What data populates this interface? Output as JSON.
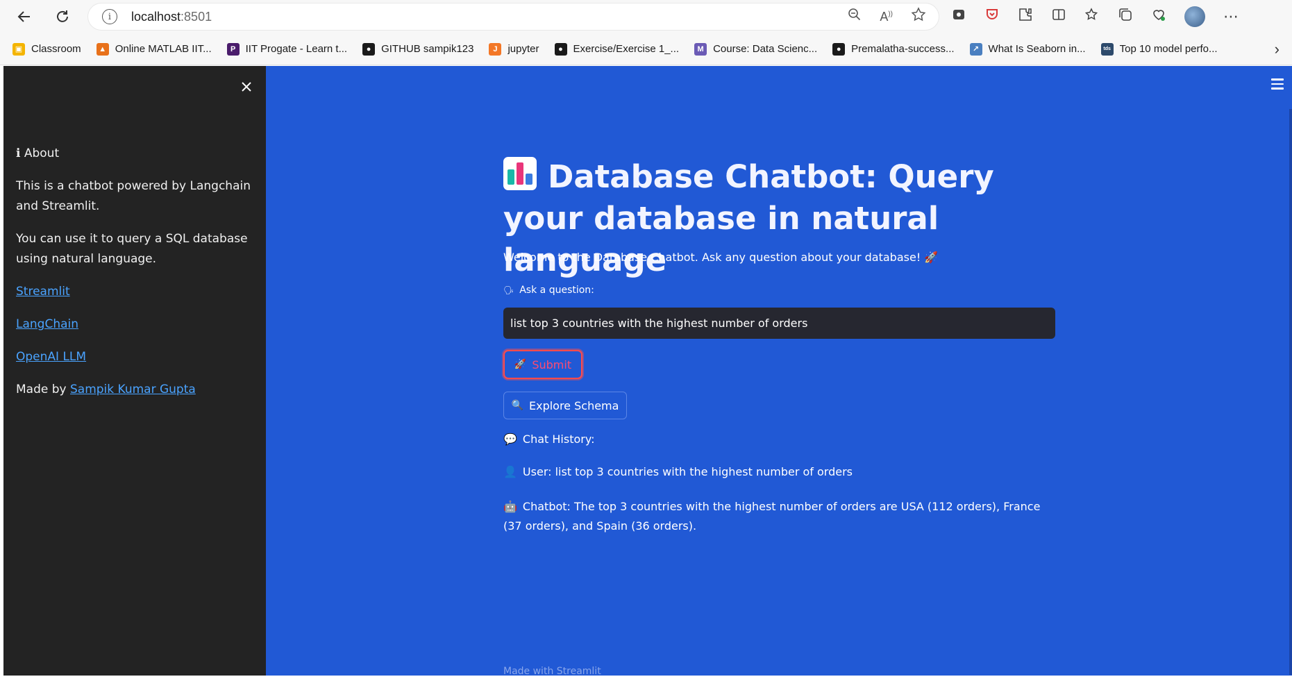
{
  "browser": {
    "url_host": "localhost",
    "url_port": ":8501",
    "bookmarks": [
      {
        "label": "Classroom",
        "color": "#f4b400",
        "glyph": "▣"
      },
      {
        "label": "Online MATLAB IIT...",
        "color": "#e8711a",
        "glyph": "▲"
      },
      {
        "label": "IIT Progate - Learn t...",
        "color": "#4a1c6b",
        "glyph": "P"
      },
      {
        "label": "GITHUB sampik123",
        "color": "#1a1a1a",
        "glyph": "●"
      },
      {
        "label": "jupyter",
        "color": "#f37726",
        "glyph": "J"
      },
      {
        "label": "Exercise/Exercise 1_...",
        "color": "#1a1a1a",
        "glyph": "●"
      },
      {
        "label": "Course: Data Scienc...",
        "color": "#6b5bb5",
        "glyph": "M"
      },
      {
        "label": "Premalatha-success...",
        "color": "#1a1a1a",
        "glyph": "●"
      },
      {
        "label": "What Is Seaborn in...",
        "color": "#4a7fc0",
        "glyph": "↗"
      },
      {
        "label": "Top 10 model perfo...",
        "color": "#2d4a6b",
        "glyph": "tds"
      }
    ]
  },
  "sidebar": {
    "about_heading": "ℹ About",
    "para1": "This is a chatbot powered by Langchain and Streamlit.",
    "para2": "You can use it to query a SQL database using natural language.",
    "link_streamlit": "Streamlit",
    "link_langchain": "LangChain",
    "link_openai": "OpenAI LLM",
    "made_by_prefix": "Made by ",
    "made_by_link": "Sampik Kumar Gupta"
  },
  "main": {
    "title": "Database Chatbot: Query your database in natural language",
    "welcome": "Welcome to the Database Chatbot. Ask any question about your database! 🚀",
    "ask_label": "Ask a question:",
    "question_value": "list top 3 countries with the highest number of orders",
    "submit_label": "Submit",
    "explore_label": "Explore Schema",
    "history_label": "Chat History:",
    "user_message": "User: list top 3 countries with the highest number of orders",
    "bot_message": "Chatbot: The top 3 countries with the highest number of orders are USA (112 orders), France (37 orders), and Spain (36 orders).",
    "footer": "Made with Streamlit"
  },
  "colors": {
    "main_bg": "#2159d5",
    "sidebar_bg": "#232323",
    "input_bg": "#262730",
    "submit_accent": "#ff4b4b",
    "link": "#4aa3ff"
  }
}
